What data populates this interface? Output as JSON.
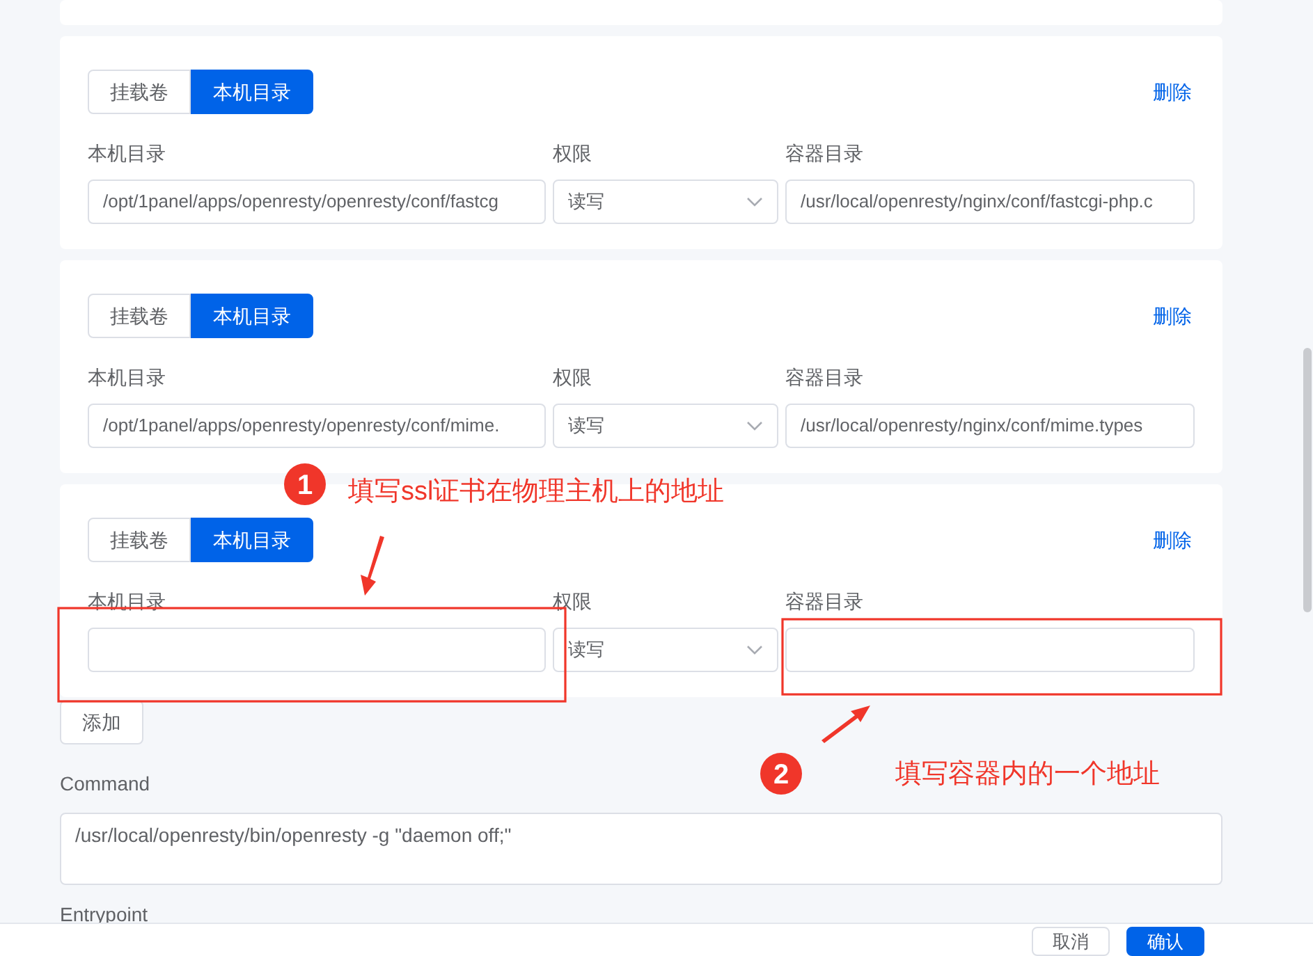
{
  "mounts": [
    {
      "types": [
        {
          "label": "挂载卷",
          "selected": false
        },
        {
          "label": "本机目录",
          "selected": true
        }
      ],
      "delete": "删除",
      "host_label": "本机目录",
      "host": "/opt/1panel/apps/openresty/openresty/conf/fastcg",
      "perm_label": "权限",
      "perm": "读写",
      "container_label": "容器目录",
      "container": "/usr/local/openresty/nginx/conf/fastcgi-php.c"
    },
    {
      "types": [
        {
          "label": "挂载卷",
          "selected": false
        },
        {
          "label": "本机目录",
          "selected": true
        }
      ],
      "delete": "删除",
      "host_label": "本机目录",
      "host": "/opt/1panel/apps/openresty/openresty/conf/mime.",
      "perm_label": "权限",
      "perm": "读写",
      "container_label": "容器目录",
      "container": "/usr/local/openresty/nginx/conf/mime.types"
    },
    {
      "types": [
        {
          "label": "挂载卷",
          "selected": false
        },
        {
          "label": "本机目录",
          "selected": true
        }
      ],
      "delete": "删除",
      "host_label": "本机目录",
      "perm_label": "权限",
      "perm": "读写",
      "container_label": "容器目录"
    }
  ],
  "add_button": "添加",
  "command": {
    "label": "Command",
    "value": "/usr/local/openresty/bin/openresty -g \"daemon off;\""
  },
  "entrypoint_label": "Entrypoint",
  "footer": {
    "buttons": [
      {
        "label": "取消",
        "kind": "secondary"
      },
      {
        "label": "确认",
        "kind": "primary"
      }
    ]
  },
  "annotations": [
    {
      "number": "1",
      "text": "填写ssl证书在物理主机上的地址"
    },
    {
      "number": "2",
      "text": "填写容器内的一个地址"
    }
  ]
}
